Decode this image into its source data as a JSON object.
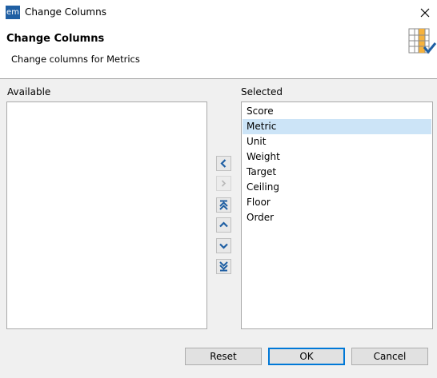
{
  "window": {
    "app_icon_text": "em",
    "title": "Change Columns",
    "close_glyph": "✕"
  },
  "header": {
    "title": "Change Columns",
    "description": "Change columns for Metrics",
    "icon": "table-columns-check-icon"
  },
  "available": {
    "label": "Available",
    "items": []
  },
  "selected": {
    "label": "Selected",
    "items": [
      "Score",
      "Metric",
      "Unit",
      "Weight",
      "Target",
      "Ceiling",
      "Floor",
      "Order"
    ],
    "selected_item": "Metric"
  },
  "move_buttons": [
    {
      "name": "move-left-button",
      "icon": "chevron-left-icon",
      "enabled": true
    },
    {
      "name": "move-right-button",
      "icon": "chevron-right-icon",
      "enabled": false
    },
    {
      "name": "move-top-button",
      "icon": "move-to-top-icon",
      "enabled": true
    },
    {
      "name": "move-up-button",
      "icon": "chevron-up-icon",
      "enabled": true
    },
    {
      "name": "move-down-button",
      "icon": "chevron-down-icon",
      "enabled": true
    },
    {
      "name": "move-bottom-button",
      "icon": "move-to-bottom-icon",
      "enabled": true
    }
  ],
  "buttons": {
    "reset": "Reset",
    "ok": "OK",
    "cancel": "Cancel"
  },
  "colors": {
    "accent": "#0078d7",
    "selection": "#cce4f7",
    "arrow": "#1f5fa3"
  }
}
